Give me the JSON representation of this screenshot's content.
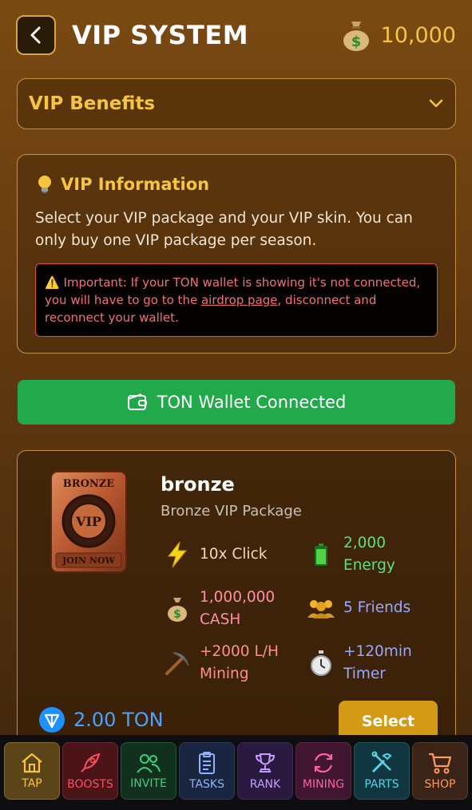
{
  "header": {
    "title": "VIP SYSTEM",
    "balance": "10,000",
    "icons": [
      "chevron-left-icon",
      "money-bag-icon"
    ]
  },
  "accordion": {
    "title": "VIP Benefits",
    "icon": "chevron-down-icon"
  },
  "info": {
    "title": "VIP Information",
    "text": "Select your VIP package and your VIP skin. You can only buy one VIP package per season.",
    "warning_prefix": "⚠️ Important: If your TON wallet is showing it's not connected, you will have to go to the ",
    "warning_link": "airdrop page",
    "warning_suffix": ", disconnect and reconnect your wallet."
  },
  "wallet": {
    "label": "TON Wallet Connected"
  },
  "package": {
    "badge_top": "BRONZE",
    "badge_center": "VIP",
    "badge_bottom": "JOIN NOW",
    "name": "bronze",
    "subtitle": "Bronze VIP Package",
    "features": {
      "click": "10x Click",
      "energy_value": "2,000",
      "energy_label": "Energy",
      "cash_value": "1,000,000",
      "cash_label": "CASH",
      "friends": "5 Friends",
      "mining_value": "+2000 L/H",
      "mining_label": "Mining",
      "timer_value": "+120min",
      "timer_label": "Timer"
    },
    "price": "2.00 TON",
    "select_label": "Select"
  },
  "nav": {
    "items": [
      {
        "label": "TAP",
        "color": "#f5c542"
      },
      {
        "label": "BOOSTS",
        "color": "#ff4d5e"
      },
      {
        "label": "INVITE",
        "color": "#3dd17a"
      },
      {
        "label": "TASKS",
        "color": "#8fb3ff"
      },
      {
        "label": "RANK",
        "color": "#c79bff"
      },
      {
        "label": "MINING",
        "color": "#ff5fa8"
      },
      {
        "label": "PARTS",
        "color": "#4fd6e8"
      },
      {
        "label": "SHOP",
        "color": "#ff9a5c"
      }
    ]
  },
  "colors": {
    "accent": "#f5c542",
    "wallet_green": "#22a94c",
    "select": "#d39a16",
    "ton_blue": "#4aa3ff"
  }
}
